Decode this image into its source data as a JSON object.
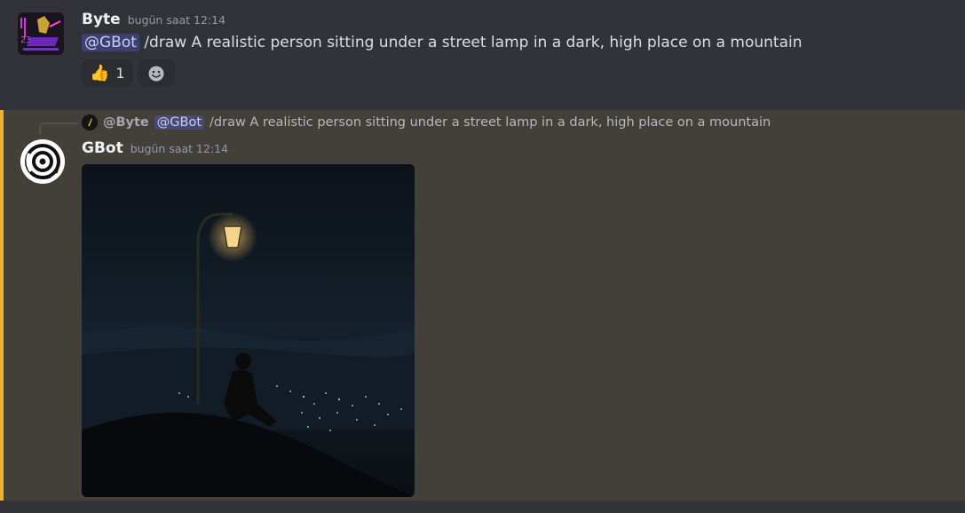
{
  "message1": {
    "author": "Byte",
    "timestamp": "bugün saat 12:14",
    "mention": "@GBot",
    "text": "/draw A realistic person sitting under a street lamp in a dark, high place on a mountain",
    "avatar_icon": "byte-avatar-icon",
    "reactions": [
      {
        "emoji": "👍",
        "count": "1",
        "icon": "thumbs-up-icon"
      },
      {
        "icon": "add-reaction-icon"
      }
    ]
  },
  "message2": {
    "reply": {
      "author": "@Byte",
      "mention": "@GBot",
      "text": "/draw A realistic person sitting under a street lamp in a dark, high place on a mountain"
    },
    "author": "GBot",
    "timestamp": "bugün saat 12:14",
    "avatar_icon": "gbot-avatar-icon",
    "attachment": "generated-image"
  },
  "colors": {
    "background": "#313338",
    "highlight_bg": "#433f39",
    "highlight_border": "#f0b132",
    "mention_bg": "#4a4f8a",
    "mention_text": "#c9cdfb"
  }
}
